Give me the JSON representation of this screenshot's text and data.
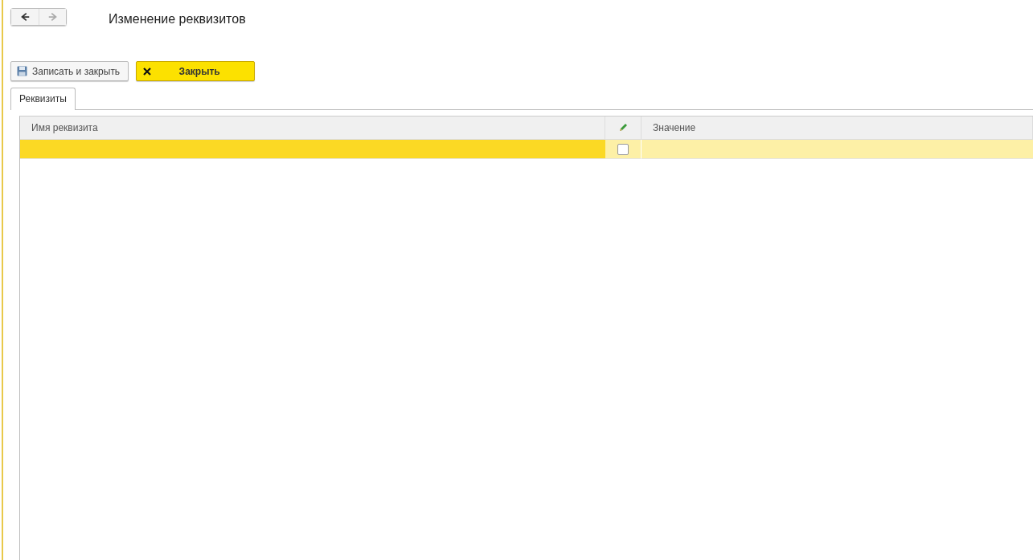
{
  "navigation": {
    "back_disabled": false,
    "forward_disabled": true
  },
  "window": {
    "title": "Изменение реквизитов"
  },
  "buttons": [
    {
      "kind": "save",
      "label": "Записать и закрыть"
    },
    {
      "kind": "close",
      "label": "Закрыть"
    }
  ],
  "tabs": [
    {
      "label": "Реквизиты",
      "selected": true
    }
  ],
  "table": {
    "columns": [
      {
        "kind": "text",
        "label": "Имя реквизита"
      },
      {
        "kind": "edit"
      },
      {
        "kind": "text",
        "label": "Значение"
      }
    ],
    "rows": [
      {
        "checked": false,
        "selected": true
      }
    ]
  }
}
